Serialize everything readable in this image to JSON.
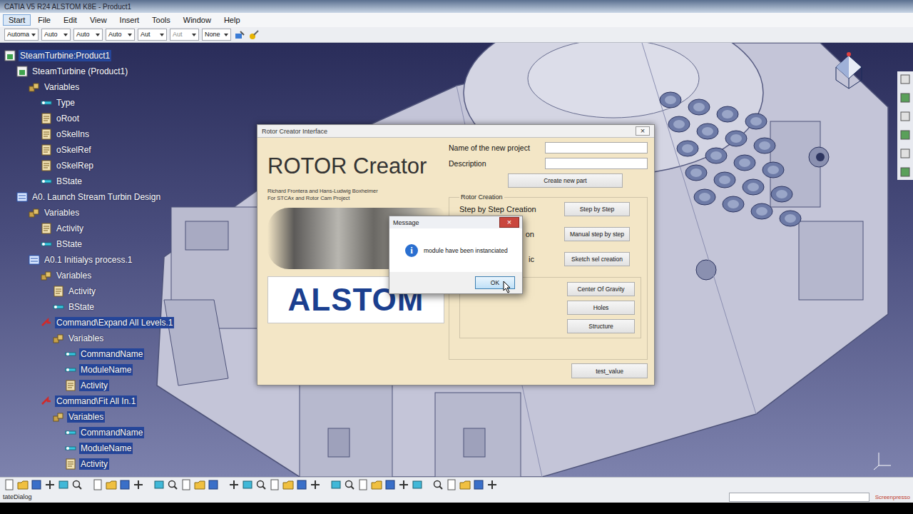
{
  "window": {
    "title": "CATIA V5 R24 ALSTOM K8E - Product1"
  },
  "menu": [
    {
      "label": "Start",
      "selected": true
    },
    {
      "label": "File",
      "selected": false
    },
    {
      "label": "Edit",
      "selected": false
    },
    {
      "label": "View",
      "selected": false
    },
    {
      "label": "Insert",
      "selected": false
    },
    {
      "label": "Tools",
      "selected": false
    },
    {
      "label": "Window",
      "selected": false
    },
    {
      "label": "Help",
      "selected": false
    }
  ],
  "toolbar": {
    "dropdowns": [
      {
        "value": "Automa",
        "disabled": false
      },
      {
        "value": "Auto",
        "disabled": false
      },
      {
        "value": "Auto",
        "disabled": false
      },
      {
        "value": "Auto",
        "disabled": false
      },
      {
        "value": "Aut",
        "disabled": false
      },
      {
        "value": "Aut",
        "disabled": true
      },
      {
        "value": "None",
        "disabled": false
      }
    ]
  },
  "tree": [
    {
      "label": "SteamTurbine:Product1",
      "level": 0,
      "kind": "product",
      "selected": true
    },
    {
      "label": "SteamTurbine (Product1)",
      "level": 1,
      "kind": "product",
      "selected": false
    },
    {
      "label": "Variables",
      "level": 2,
      "kind": "variables",
      "selected": false
    },
    {
      "label": "Type",
      "level": 3,
      "kind": "param",
      "selected": false
    },
    {
      "label": "oRoot",
      "level": 3,
      "kind": "object",
      "selected": false
    },
    {
      "label": "oSkelIns",
      "level": 3,
      "kind": "object",
      "selected": false
    },
    {
      "label": "oSkelRef",
      "level": 3,
      "kind": "object",
      "selected": false
    },
    {
      "label": "oSkelRep",
      "level": 3,
      "kind": "object",
      "selected": false
    },
    {
      "label": "BState",
      "level": 3,
      "kind": "param",
      "selected": false
    },
    {
      "label": "A0. Launch Stream Turbin Design",
      "level": 1,
      "kind": "process",
      "selected": false
    },
    {
      "label": "Variables",
      "level": 2,
      "kind": "variables",
      "selected": false
    },
    {
      "label": "Activity",
      "level": 3,
      "kind": "object",
      "selected": false
    },
    {
      "label": "BState",
      "level": 3,
      "kind": "param",
      "selected": false
    },
    {
      "label": "A0.1 Initialys process.1",
      "level": 2,
      "kind": "process",
      "selected": false
    },
    {
      "label": "Variables",
      "level": 3,
      "kind": "variables",
      "selected": false
    },
    {
      "label": "Activity",
      "level": 4,
      "kind": "object",
      "selected": false
    },
    {
      "label": "BState",
      "level": 4,
      "kind": "param",
      "selected": false
    },
    {
      "label": "Command\\Expand All Levels.1",
      "level": 3,
      "kind": "command",
      "selected": true
    },
    {
      "label": "Variables",
      "level": 4,
      "kind": "variables",
      "selected": false
    },
    {
      "label": "CommandName",
      "level": 5,
      "kind": "param",
      "selected": true
    },
    {
      "label": "ModuleName",
      "level": 5,
      "kind": "param",
      "selected": true
    },
    {
      "label": "Activity",
      "level": 5,
      "kind": "object",
      "selected": true
    },
    {
      "label": "Command\\Fit All In.1",
      "level": 3,
      "kind": "command",
      "selected": true
    },
    {
      "label": "Variables",
      "level": 4,
      "kind": "variables",
      "selected": true
    },
    {
      "label": "CommandName",
      "level": 5,
      "kind": "param",
      "selected": true
    },
    {
      "label": "ModuleName",
      "level": 5,
      "kind": "param",
      "selected": true
    },
    {
      "label": "Activity",
      "level": 5,
      "kind": "object",
      "selected": true
    }
  ],
  "dialog": {
    "title": "Rotor Creator Interface",
    "close": "×",
    "heading": "ROTOR Creator",
    "credits": [
      "Richard Frontera and Hans-Ludwig Boxheimer",
      "For STCAx and Rotor Cam Project"
    ],
    "logo": "ALSTOM",
    "fields": [
      {
        "label": "Name of the new project",
        "value": ""
      },
      {
        "label": "Description",
        "value": ""
      }
    ],
    "create_button": "Create new part",
    "group": {
      "title": "Rotor Creation",
      "rows": [
        {
          "label": "Step by Step Creation",
          "clipped": false,
          "button": "Step by Step"
        },
        {
          "label": "on",
          "clipped": true,
          "button": "Manual step by step"
        },
        {
          "label": "ic",
          "clipped": true,
          "button": "Sketch sel creation"
        }
      ],
      "tools": [
        "Center Of Gravity",
        "Holes",
        "Structure"
      ]
    },
    "test_button": "test_value"
  },
  "message": {
    "title": "Message",
    "close": "×",
    "icon": "i",
    "text": "module have been instanciated",
    "button": {
      "label": "OK",
      "focused": true
    }
  },
  "status_bar": {
    "text": "tateDialog",
    "watermark": "Screenpresso"
  }
}
